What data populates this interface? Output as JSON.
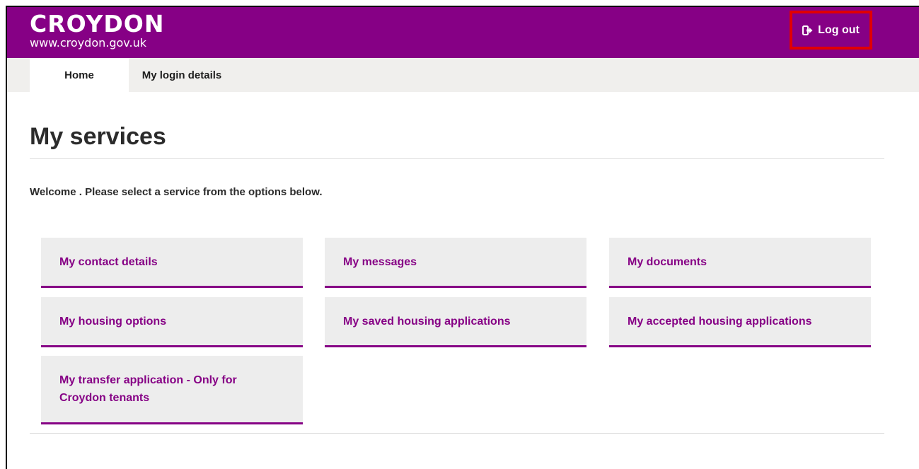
{
  "header": {
    "logo_name": "CROYDON",
    "logo_url": "www.croydon.gov.uk",
    "logout_label": "Log out",
    "brand_color": "#860085",
    "highlight_color": "#e10000"
  },
  "nav": {
    "items": [
      {
        "label": "Home",
        "active": true
      },
      {
        "label": "My login details",
        "active": false
      }
    ]
  },
  "main": {
    "title": "My services",
    "welcome": "Welcome . Please select a service from the options below.",
    "services": [
      {
        "label": "My contact details"
      },
      {
        "label": "My messages"
      },
      {
        "label": "My documents"
      },
      {
        "label": "My housing options"
      },
      {
        "label": "My saved housing applications"
      },
      {
        "label": "My accepted housing applications"
      },
      {
        "label": "My transfer application - Only for Croydon tenants"
      }
    ]
  },
  "icons": {
    "logout": "logout-icon"
  }
}
